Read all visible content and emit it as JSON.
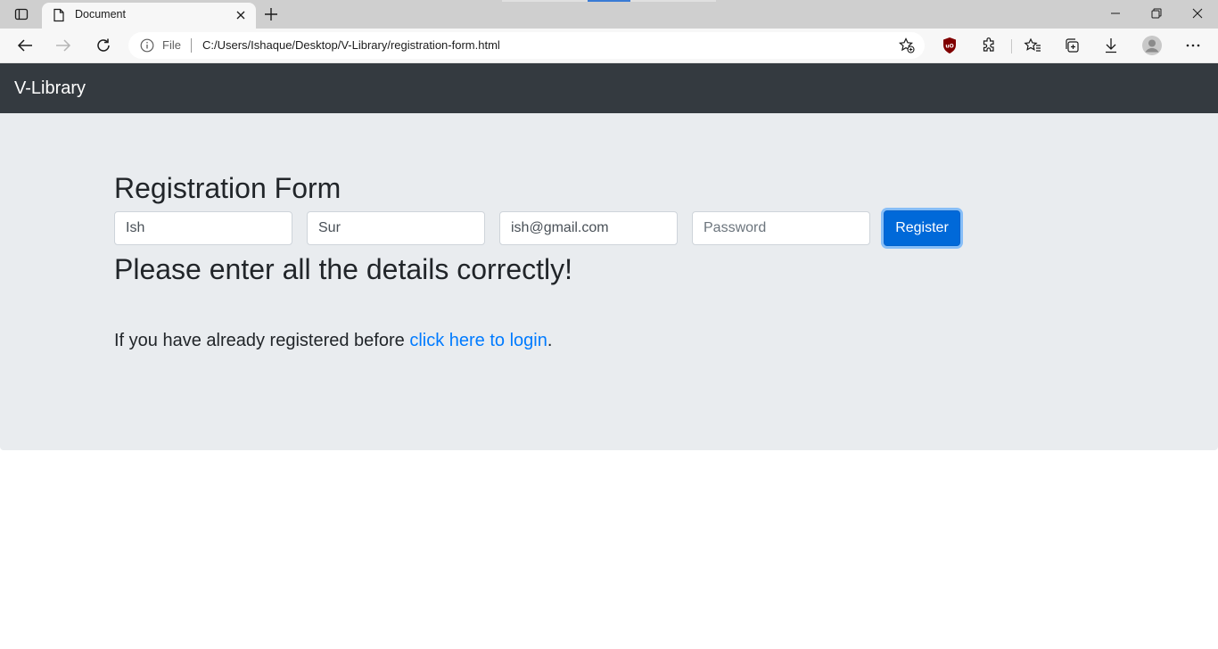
{
  "browser": {
    "tab": {
      "title": "Document"
    },
    "address": {
      "scheme_label": "File",
      "url": "C:/Users/Ishaque/Desktop/V-Library/registration-form.html"
    },
    "icons": [
      "tab-actions-icon",
      "page-icon",
      "close-icon",
      "plus-icon",
      "minimize-icon",
      "restore-icon",
      "close-window-icon",
      "back-arrow-icon",
      "forward-arrow-icon",
      "refresh-icon",
      "info-icon",
      "add-favorite-icon",
      "ublock-icon",
      "extensions-icon",
      "favorites-icon",
      "collections-icon",
      "download-icon",
      "profile-avatar-icon",
      "more-icon"
    ]
  },
  "navbar": {
    "brand": "V-Library"
  },
  "form": {
    "title": "Registration Form",
    "first_name": {
      "value": "Ish"
    },
    "last_name": {
      "value": "Sur"
    },
    "email": {
      "value": "ish@gmail.com"
    },
    "password": {
      "placeholder": "Password"
    },
    "register_label": "Register"
  },
  "message": "Please enter all the details correctly!",
  "login_prompt": {
    "before": "If you have already registered before ",
    "link": "click here to login",
    "after": "."
  },
  "colors": {
    "navbar_bg": "#343a40",
    "jumbotron_bg": "#e9ecef",
    "primary": "#007bff",
    "button_active": "#0069d9"
  }
}
